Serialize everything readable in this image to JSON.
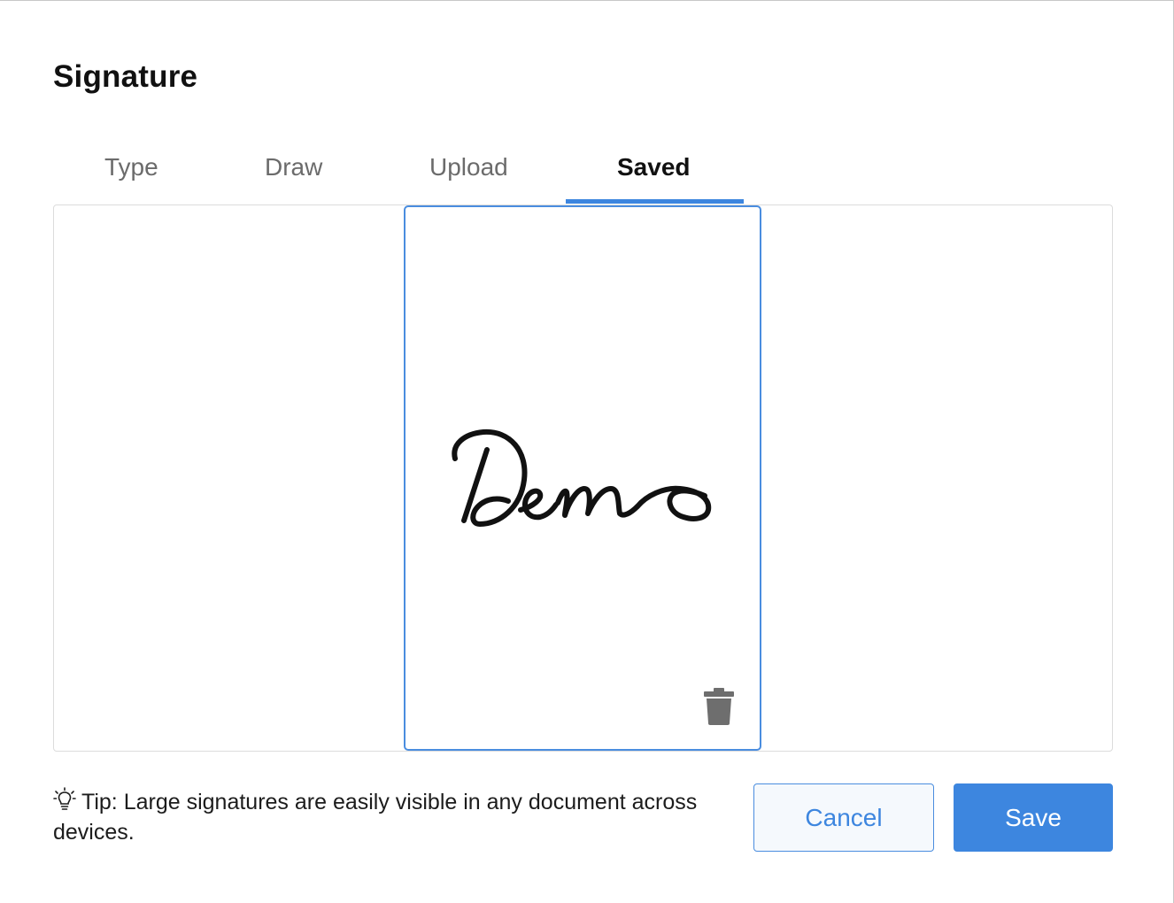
{
  "dialog": {
    "title": "Signature"
  },
  "tabs": [
    {
      "label": "Type",
      "active": false
    },
    {
      "label": "Draw",
      "active": false
    },
    {
      "label": "Upload",
      "active": false
    },
    {
      "label": "Saved",
      "active": true
    }
  ],
  "saved": {
    "signature_text": "Demo",
    "delete_icon": "trash-icon",
    "selected": true
  },
  "tip": {
    "icon": "lightbulb-icon",
    "text": "Tip: Large signatures are easily visible in any document across devices."
  },
  "actions": {
    "cancel_label": "Cancel",
    "save_label": "Save"
  },
  "colors": {
    "accent": "#3d86df",
    "title": "#111111",
    "inactive_tab": "#6b6b6b",
    "cancel_bg": "#f5f9fd"
  }
}
